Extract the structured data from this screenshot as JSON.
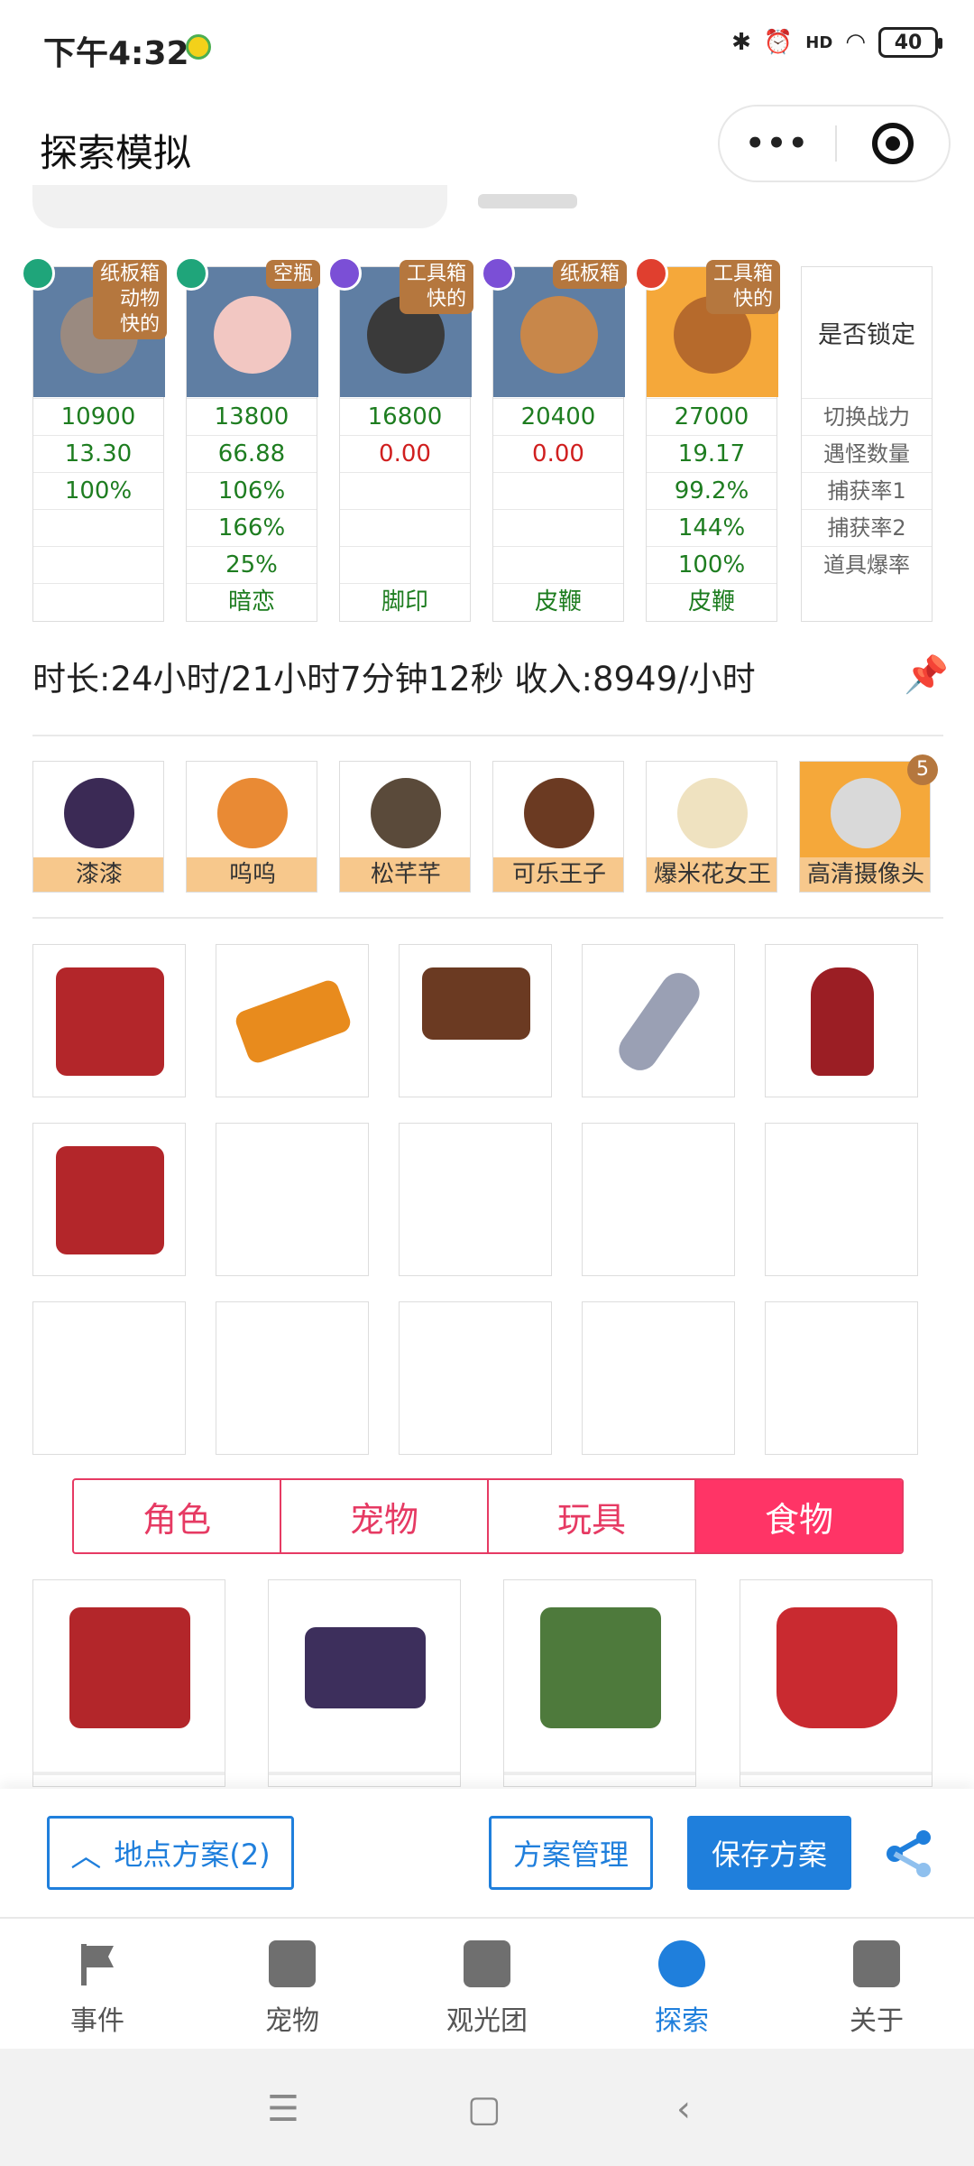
{
  "status_bar": {
    "time": "下午4:32",
    "signal": "HD",
    "battery": "40"
  },
  "titlebar": {
    "title": "探索模拟",
    "menu": "•••"
  },
  "pets": [
    {
      "tag": "纸板箱\n动物\n快的",
      "gem": "green",
      "power": "10900",
      "encounter": "13.30",
      "catch1": "100%",
      "catch2": "",
      "drop": "",
      "skill": ""
    },
    {
      "tag": "空瓶",
      "gem": "green",
      "power": "13800",
      "encounter": "66.88",
      "catch1": "106%",
      "catch2": "166%",
      "drop": "25%",
      "skill": "暗恋"
    },
    {
      "tag": "工具箱\n快的",
      "gem": "purple",
      "power": "16800",
      "encounter": "0.00",
      "catch1": "",
      "catch2": "",
      "drop": "",
      "skill": "脚印"
    },
    {
      "tag": "纸板箱",
      "gem": "purple",
      "power": "20400",
      "encounter": "0.00",
      "catch1": "",
      "catch2": "",
      "drop": "",
      "skill": "皮鞭"
    },
    {
      "tag": "工具箱\n快的",
      "gem": "red",
      "power": "27000",
      "encounter": "19.17",
      "catch1": "99.2%",
      "catch2": "144%",
      "drop": "100%",
      "skill": "皮鞭"
    }
  ],
  "legend": {
    "lock": "是否锁定",
    "power": "切换战力",
    "encounter": "遇怪数量",
    "catch1": "捕获率1",
    "catch2": "捕获率2",
    "drop": "道具爆率"
  },
  "summary": {
    "text": "时长:24小时/21小时7分钟12秒 收入:8949/小时"
  },
  "team": [
    {
      "name": "漆漆"
    },
    {
      "name": "呜呜"
    },
    {
      "name": "松芊芊"
    },
    {
      "name": "可乐王子"
    },
    {
      "name": "爆米花女王"
    },
    {
      "name": "高清摄像头",
      "count": "5"
    }
  ],
  "items": [
    "bento-box-icon",
    "flashlight-icon",
    "no-sign-icon",
    "ruler-icon",
    "fire-extinguisher-icon",
    "bento-box-icon"
  ],
  "tabs": [
    "角色",
    "宠物",
    "玩具",
    "食物"
  ],
  "active_tab": "食物",
  "foods": [
    "bento-box-icon",
    "lunch-box-icon",
    "rice-cake-icon",
    "fried-chicken-bucket-icon"
  ],
  "actions": {
    "location_plan": "地点方案(2)",
    "plan_manage": "方案管理",
    "save_plan": "保存方案"
  },
  "bottom_tabs": [
    "事件",
    "宠物",
    "观光团",
    "探索",
    "关于"
  ],
  "active_bottom_tab": "探索",
  "colors": {
    "accent": "#1f7fdc",
    "tab_pink": "#ff3466",
    "pet_bg_blue": "#5f7ea3",
    "pet_bg_orange": "#f5a83a",
    "value_green": "#1e7d20",
    "value_red": "#d01f1f"
  }
}
